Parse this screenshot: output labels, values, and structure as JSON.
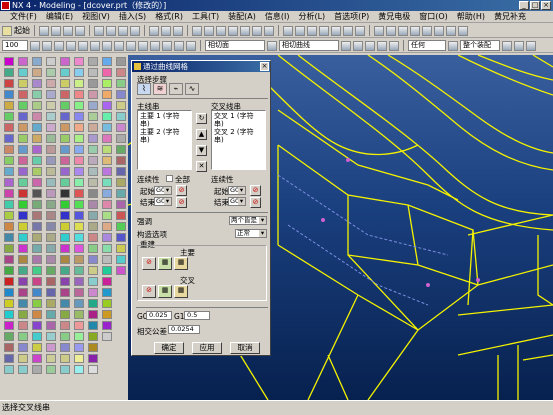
{
  "app": {
    "title": "NX 4 - Modeling - [dcover.prt（修改的）]"
  },
  "menu": [
    "文件(F)",
    "编辑(E)",
    "视图(V)",
    "插入(S)",
    "格式(R)",
    "工具(T)",
    "装配(A)",
    "信息(I)",
    "分析(L)",
    "首选项(P)",
    "黄兄电极",
    "窗口(O)",
    "帮助(H)",
    "黄兄补充"
  ],
  "toolbar1": {
    "start_label": "起始"
  },
  "toolbar2": {
    "zoom": "100",
    "filter1": "相切面",
    "filter2": "相切曲线",
    "filter3": "任何",
    "filter4": "整个装配"
  },
  "dialog": {
    "title": "通过曲线网格",
    "select_steps_label": "选择步骤",
    "primary_label": "主线串",
    "cross_label": "交叉线串",
    "primary_items": [
      "主要 1 (字符串)",
      "主要 2 (字符串)"
    ],
    "cross_items": [
      "交叉 1 (字符串)",
      "交叉 2 (字符串)"
    ],
    "continuity_label": "连续性",
    "all_label": "全部",
    "start_label": "起始",
    "end_label": "结束",
    "g0": "G0",
    "emphasis_label": "强调",
    "emphasis_value": "两个皆是",
    "construct_label": "构造选项",
    "construct_value": "正常",
    "respline_label": "重建",
    "primary_sub": "主要",
    "cross_sub": "交叉",
    "g0_label": "G0",
    "g0_value": "0.025",
    "g1_label": "G1",
    "g1_value": "0.5",
    "tolerance_label": "相交公差",
    "tolerance_value": "0.0254",
    "ok": "确定",
    "apply": "应用",
    "cancel": "取消"
  },
  "status": {
    "prompt": "选择交叉线串"
  }
}
